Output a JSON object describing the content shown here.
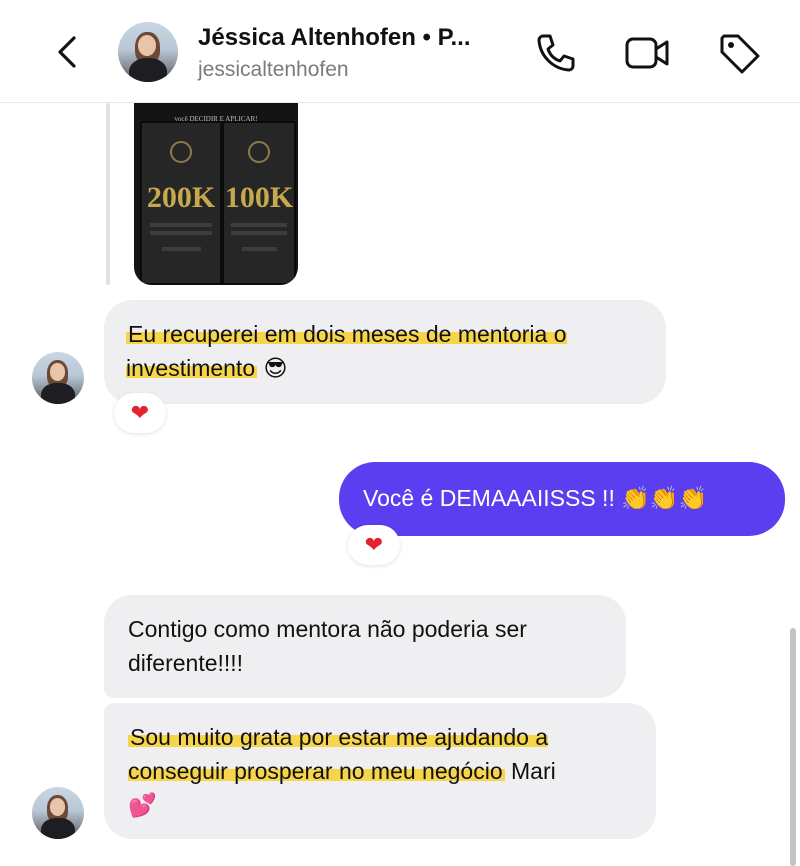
{
  "header": {
    "name": "Jéssica Altenhofen • P...",
    "username": "jessicaltenhofen",
    "icons": [
      "back-icon",
      "phone-icon",
      "video-call-icon",
      "tag-icon"
    ]
  },
  "media": {
    "caption": "você DECIDIR E APLICAR!",
    "plaque_left": "200K",
    "plaque_right": "100K"
  },
  "messages": [
    {
      "from": "contact",
      "text_highlight": "Eu recuperei em dois meses de mentoria o investimento",
      "emoji": "😎",
      "reaction": "❤"
    },
    {
      "from": "me",
      "text": "Você é DEMAAAIISSS !!",
      "emoji": "👏👏👏",
      "reaction": "❤",
      "color": "#5b3ef0"
    },
    {
      "from": "contact",
      "text": "Contigo como mentora não poderia ser diferente!!!!"
    },
    {
      "from": "contact",
      "text_highlight": "Sou muito grata por estar me ajudando a conseguir prosperar no meu negócio",
      "text_after": " Mari",
      "emoji": "💕"
    }
  ],
  "colors": {
    "sent_bubble": "#5b3ef0",
    "received_bubble": "#efeff2",
    "highlight": "#f7d54a",
    "heart": "#e4222f"
  }
}
